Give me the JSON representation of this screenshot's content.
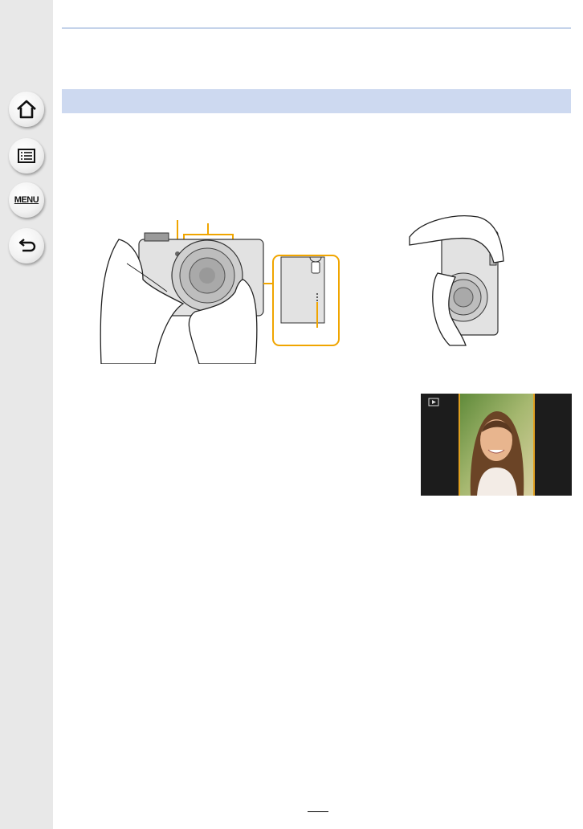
{
  "sidebar": {
    "home_icon": "home-icon",
    "contents_icon": "list-icon",
    "menu_label": "MENU",
    "back_icon": "back-arrow-icon"
  },
  "colors": {
    "sidebar_bg": "#e8e8e8",
    "section_bar": "#cdd9f0",
    "rule": "#c5d3ea",
    "callout": "#f0a500"
  }
}
